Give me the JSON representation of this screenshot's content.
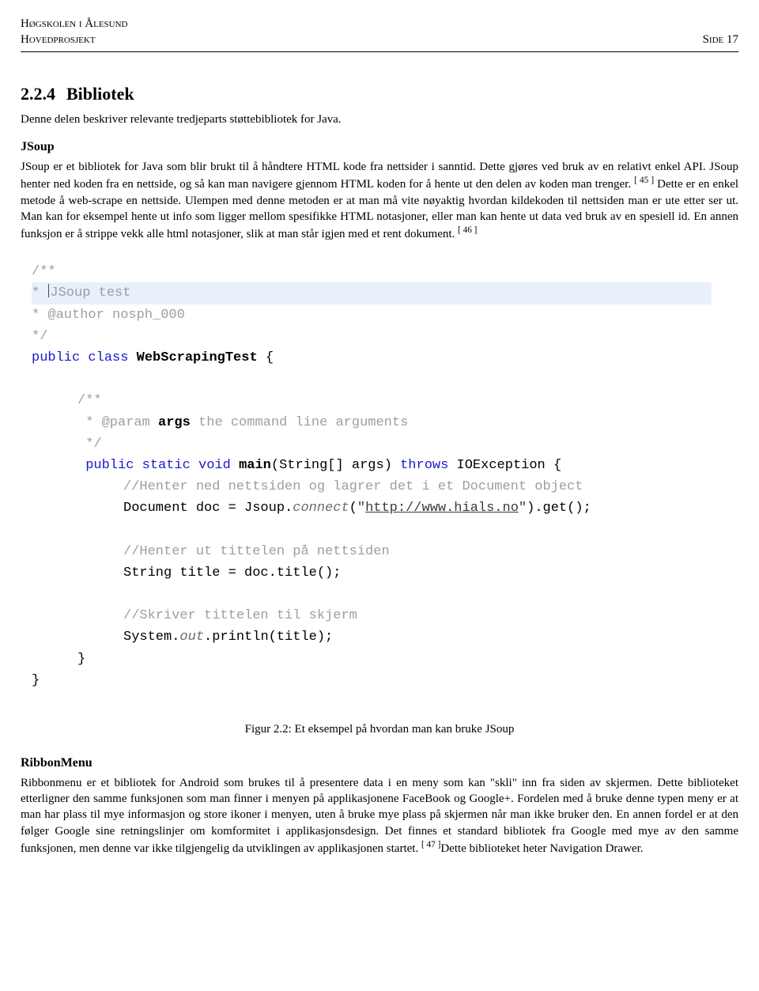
{
  "header": {
    "school": "Høgskolen i Ålesund",
    "project": "Hovedprosjekt",
    "page_label": "Side 17"
  },
  "section": {
    "number": "2.2.4",
    "title": "Bibliotek",
    "intro": "Denne delen beskriver relevante tredjeparts støttebibliotek for Java."
  },
  "jsoup": {
    "heading": "JSoup",
    "para_a": "JSoup er et bibliotek for Java som blir brukt til å håndtere HTML kode fra nettsider i sanntid. Dette gjøres ved bruk av en relativt enkel API. JSoup henter ned koden fra en nettside, og så kan man navigere gjennom HTML koden for å hente ut den delen av koden man trenger.",
    "ref_a": "[ 45 ]",
    "para_b": " Dette er en enkel metode å web-scrape en nettside. Ulempen med denne metoden er at man må vite nøyaktig hvordan kildekoden til nettsiden man er ute etter ser ut. Man kan for eksempel hente ut info som ligger mellom spesifikke HTML notasjoner, eller man kan hente ut data ved bruk av en spesiell id. En annen funksjon er å strippe vekk alle html notasjoner, slik at man står igjen med et rent dokument.",
    "ref_b": "[ 46 ]"
  },
  "code": {
    "l1": "/**",
    "l2": " * ",
    "l2b": "JSoup test",
    "l3": " * @author nosph_000",
    "l4": " */",
    "l5a": "public",
    "l5b": "class",
    "l5c": "WebScrapingTest",
    "l5d": "{",
    "l6": "/**",
    "l7a": " * @param ",
    "l7b": "args",
    "l7c": " the command line arguments",
    "l8": " */",
    "l9a": "public",
    "l9b": "static",
    "l9c": "void",
    "l9d": "main",
    "l9e": "(String[] args)",
    "l9f": "throws",
    "l9g": "IOException {",
    "l10": "//Henter ned nettsiden og lagrer det i et Document object",
    "l11a": "Document doc = Jsoup.",
    "l11b": "connect",
    "l11c": "(",
    "l11d": "\"",
    "l11url": "http://www.hials.no",
    "l11e": "\"",
    "l11f": ").get();",
    "l12": "//Henter ut tittelen på nettsiden",
    "l13": "String title = doc.title();",
    "l14": "//Skriver tittelen til skjerm",
    "l15a": "System.",
    "l15b": "out",
    "l15c": ".println(title);",
    "l16": "}",
    "l17": "}"
  },
  "figure": {
    "caption": "Figur 2.2: Et eksempel på hvordan man kan bruke JSoup"
  },
  "ribbon": {
    "heading": "RibbonMenu",
    "para_a": "Ribbonmenu er et bibliotek for Android som brukes til å presentere data i en meny som kan \"skli\" inn fra siden av skjermen. Dette biblioteket etterligner den samme funksjonen som man finner i menyen på applikasjonene FaceBook og Google+. Fordelen med å bruke denne typen meny er at man har plass til mye informasjon og store ikoner i menyen, uten å bruke mye plass på skjermen når man ikke bruker den. En annen fordel er at den følger Google sine retningslinjer om komformitet i applikasjonsdesign. Det finnes et standard bibliotek fra Google med mye av den samme funksjonen, men denne var ikke tilgjengelig da utviklingen av applikasjonen startet.",
    "ref": "[ 47 ]",
    "para_b": "Dette biblioteket heter Navigation Drawer."
  }
}
